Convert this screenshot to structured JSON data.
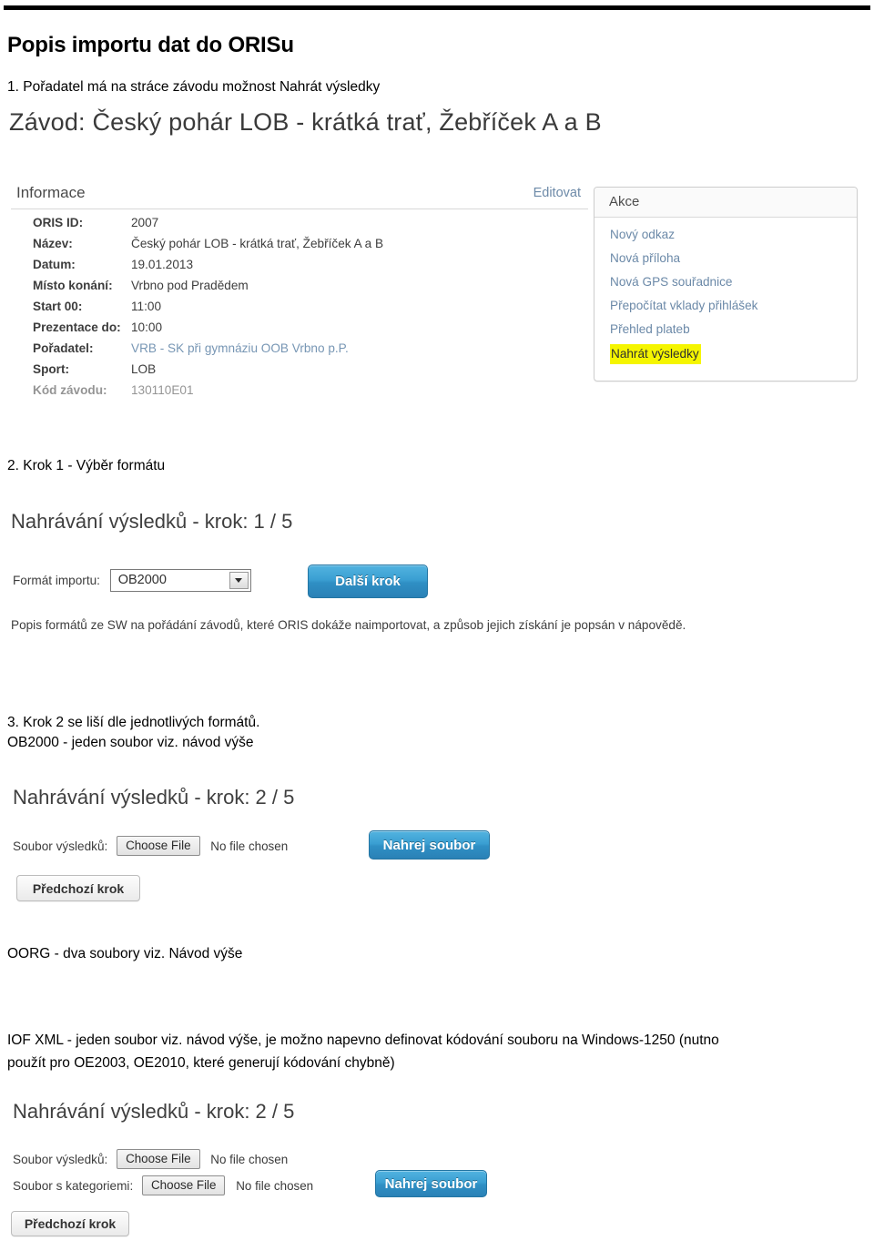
{
  "document": {
    "title": "Popis importu dat do ORISu",
    "steps": [
      {
        "id": 1,
        "text": "1. Pořadatel má na stráce závodu možnost Nahrát výsledky"
      },
      {
        "id": 2,
        "text": "2. Krok 1 - Výběr formátu"
      },
      {
        "id": 3,
        "line1": "3. Krok 2 se liší dle jednotlivých formátů.",
        "line2": "OB2000 - jeden soubor viz. návod výše"
      }
    ],
    "note_oorg": "OORG - dva soubory viz. Návod výše",
    "note_iof_line1": "IOF XML - jeden soubor viz. návod výše, je možno napevno definovat kódování souboru na Windows-1250 (nutno",
    "note_iof_line2": "použít pro OE2003, OE2010, které generují kódování chybně)"
  },
  "race_screenshot": {
    "heading": "Závod: Český pohár LOB - krátká trať, Žebříček A a B",
    "info_panel": {
      "title": "Informace",
      "edit_link": "Editovat",
      "rows": [
        {
          "label": "ORIS ID:",
          "value": "2007"
        },
        {
          "label": "Název:",
          "value": "Český pohár LOB - krátká trať, Žebříček A a B"
        },
        {
          "label": "Datum:",
          "value": "19.01.2013"
        },
        {
          "label": "Místo konání:",
          "value": "Vrbno pod Pradědem"
        },
        {
          "label": "Start 00:",
          "value": "11:00"
        },
        {
          "label": "Prezentace do:",
          "value": "10:00"
        },
        {
          "label": "Pořadatel:",
          "value": "VRB - SK při gymnáziu OOB Vrbno p.P."
        },
        {
          "label": "Sport:",
          "value": "LOB"
        },
        {
          "label": "Kód závodu:",
          "value": "130110E01"
        }
      ]
    },
    "akce_panel": {
      "title": "Akce",
      "items": [
        {
          "label": "Nový odkaz",
          "highlighted": false
        },
        {
          "label": "Nová příloha",
          "highlighted": false
        },
        {
          "label": "Nová GPS souřadnice",
          "highlighted": false
        },
        {
          "label": "Přepočítat vklady přihlášek",
          "highlighted": false
        },
        {
          "label": "Přehled plateb",
          "highlighted": false
        },
        {
          "label": "Nahrát výsledky",
          "highlighted": true
        }
      ],
      "highlight_color": "#f5f500"
    }
  },
  "step1_screenshot": {
    "heading": "Nahrávání výsledků - krok: 1 / 5",
    "format_label": "Formát importu:",
    "format_value": "OB2000",
    "next_button": "Další krok",
    "description": "Popis formátů ze SW na pořádání závodů, které ORIS dokáže naimportovat, a způsob jejich získání je popsán v nápovědě."
  },
  "step2_ob2000_screenshot": {
    "heading": "Nahrávání výsledků - krok: 2 / 5",
    "file_label": "Soubor výsledků:",
    "file_button": "Choose File",
    "file_status": "No file chosen",
    "upload_button": "Nahrej soubor",
    "prev_button": "Předchozí krok"
  },
  "step2_iof_screenshot": {
    "heading": "Nahrávání výsledků - krok: 2 / 5",
    "file_label_results": "Soubor výsledků:",
    "file_label_categories": "Soubor s kategoriemi:",
    "file_button": "Choose File",
    "file_status": "No file chosen",
    "upload_button": "Nahrej soubor",
    "prev_button": "Předchozí krok"
  },
  "colors": {
    "button_blue": "#2f8fc4",
    "link_blue": "#6b89a8",
    "highlight_yellow": "#f5f500"
  }
}
